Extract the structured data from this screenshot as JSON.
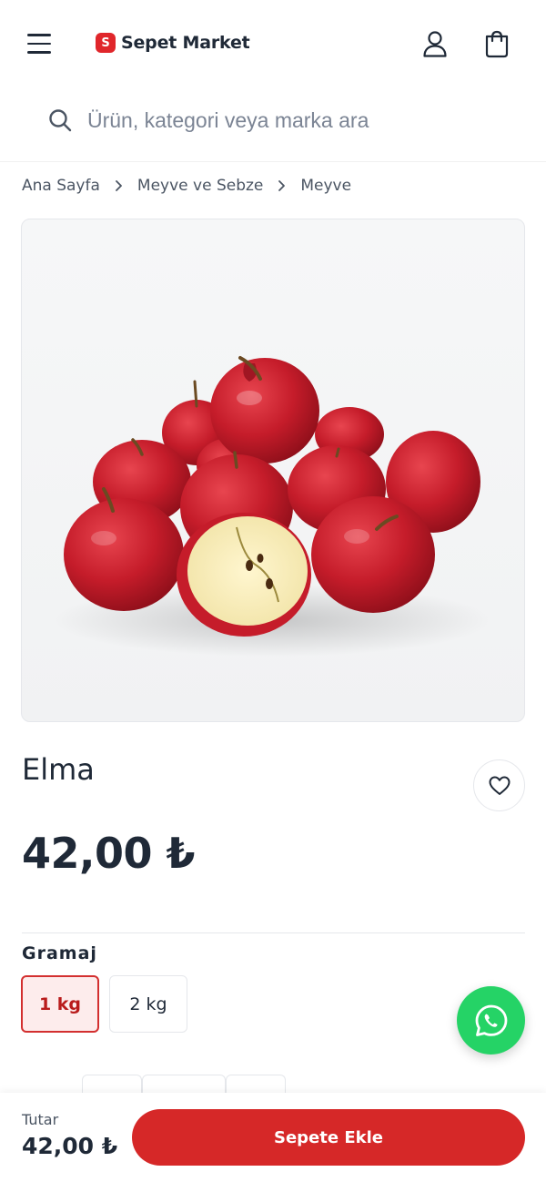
{
  "header": {
    "logo_mark": "S",
    "logo_text": "Sepet Market"
  },
  "search": {
    "placeholder": "Ürün, kategori veya marka ara"
  },
  "breadcrumb": {
    "items": [
      "Ana Sayfa",
      "Meyve ve Sebze",
      "Meyve"
    ]
  },
  "product": {
    "title": "Elma",
    "price": "42,00 ₺"
  },
  "options": {
    "label": "Gramaj",
    "items": [
      {
        "label": "1 kg",
        "selected": true
      },
      {
        "label": "2 kg",
        "selected": false
      }
    ]
  },
  "footer": {
    "total_label": "Tutar",
    "total_value": "42,00 ₺",
    "add_to_cart": "Sepete Ekle"
  },
  "colors": {
    "brand_red": "#d62828",
    "whatsapp_green": "#25d366",
    "text_dark": "#1f2937"
  },
  "icons": [
    "menu-icon",
    "user-icon",
    "cart-icon",
    "search-icon",
    "chevron-right-icon",
    "heart-icon",
    "whatsapp-icon"
  ]
}
